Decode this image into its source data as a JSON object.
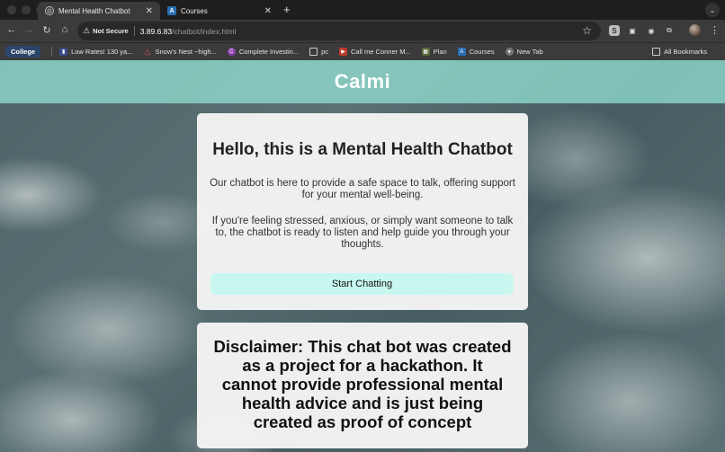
{
  "browser": {
    "tabs": [
      {
        "title": "Mental Health Chatbot",
        "active": true,
        "icon": "globe-icon"
      },
      {
        "title": "Courses",
        "active": false,
        "icon": "canvas-icon"
      }
    ],
    "new_tab_symbol": "+",
    "address": {
      "security_label": "Not Secure",
      "host": "3.89.6.83",
      "path": "/chatbot/index.html"
    },
    "bookmarks": [
      {
        "label": "College",
        "icon": ""
      },
      {
        "label": "Low Rates! 130 ya...",
        "icon": "ad-icon",
        "color": "#3b4a8a"
      },
      {
        "label": "Snow's Nest ~high...",
        "icon": "airbnb-icon",
        "color": "#e0565b"
      },
      {
        "label": "Complete Investin...",
        "icon": "course-icon",
        "color": "#8e44ad"
      },
      {
        "label": "pc",
        "icon": "folder-icon",
        "color": ""
      },
      {
        "label": "Call me Conner M...",
        "icon": "video-icon",
        "color": "#c0392b"
      },
      {
        "label": "Plan",
        "icon": "plan-icon",
        "color": "#5a6b3a"
      },
      {
        "label": "Courses",
        "icon": "canvas-icon",
        "color": "#2b6fb6"
      },
      {
        "label": "New Tab",
        "icon": "chrome-icon",
        "color": "#777"
      }
    ],
    "all_bookmarks_label": "All Bookmarks"
  },
  "page": {
    "brand": "Calmi",
    "heading": "Hello, this is a Mental Health Chatbot",
    "intro": "Our chatbot is here to provide a safe space to talk, offering support for your mental well-being.",
    "support_text": "If you're feeling stressed, anxious, or simply want someone to talk to, the chatbot is ready to listen and help guide you through your thoughts.",
    "start_button": "Start Chatting",
    "disclaimer": "Disclaimer: This chat bot was created as a project for a hackathon. It cannot provide professional mental health advice and is just being created as proof of concept"
  },
  "colors": {
    "header_band": "#96e6d7",
    "button_bg": "#c8f7ef",
    "browser_chrome": "#3b3b3b"
  }
}
